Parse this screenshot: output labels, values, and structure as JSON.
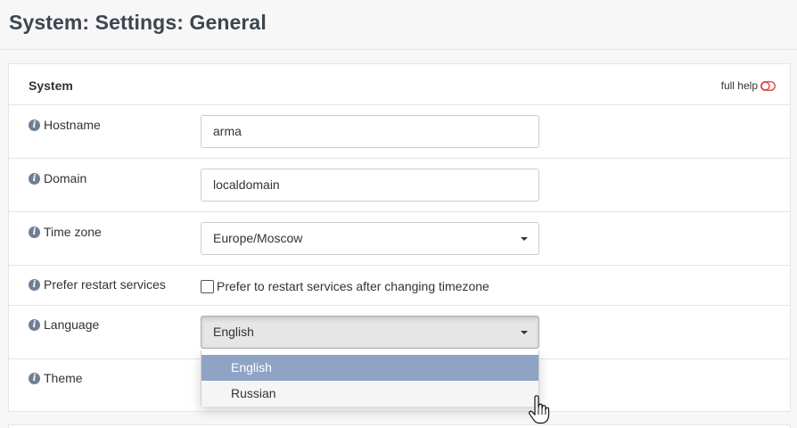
{
  "page": {
    "title": "System: Settings: General"
  },
  "panel": {
    "section_title": "System",
    "full_help": "full help",
    "help_toggle_color": "#e03a3a"
  },
  "fields": {
    "hostname": {
      "label": "Hostname",
      "value": "arma"
    },
    "domain": {
      "label": "Domain",
      "value": "localdomain"
    },
    "timezone": {
      "label": "Time zone",
      "value": "Europe/Moscow"
    },
    "prefer_restart": {
      "label": "Prefer restart services",
      "checkbox_label": "Prefer to restart services after changing timezone",
      "checked": false
    },
    "language": {
      "label": "Language",
      "value": "English",
      "options": [
        "English",
        "Russian"
      ],
      "selected_option": "English",
      "hovered_option": "Russian"
    },
    "theme": {
      "label": "Theme"
    }
  },
  "colors": {
    "title": "#3b4650",
    "info_icon": "#6f7f93",
    "selected_option_bg": "#8fa4c4"
  }
}
